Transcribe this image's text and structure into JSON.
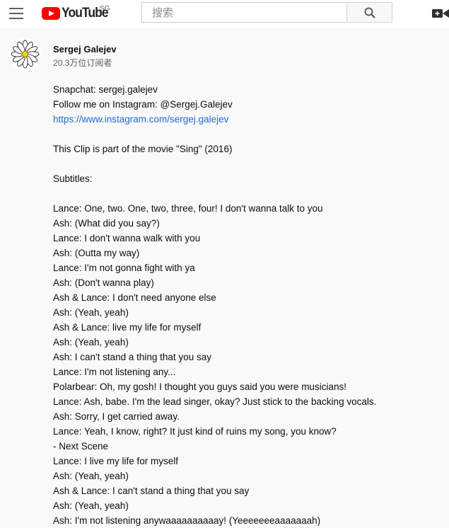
{
  "header": {
    "logo_text": "YouTube",
    "region": "SG",
    "search_placeholder": "搜索"
  },
  "channel": {
    "name": "Sergej Galejev",
    "subscribers": "20.3万位订阅者"
  },
  "description": {
    "snapchat": "Snapchat: sergej.galejev",
    "instagram": "Follow me on Instagram: @Sergej.Galejev",
    "link": "https://www.instagram.com/sergej.galejev",
    "clip": "This Clip is part of the movie \"Sing\" (2016)",
    "subtitles_heading": "Subtitles:",
    "lines": [
      "Lance: One, two. One, two, three, four! I don't wanna talk to you",
      "Ash: (What did you say?)",
      "Lance: I don't wanna walk with you",
      "Ash: (Outta my way)",
      "Lance: I'm not gonna fight with ya",
      "Ash: (Don't wanna play)",
      "Ash & Lance: I don't need anyone else",
      "Ash: (Yeah, yeah)",
      "Ash & Lance: live my life for myself",
      "Ash: (Yeah, yeah)",
      "Ash: I can't stand a thing that you say",
      "Lance: I'm not listening any...",
      "Polarbear: Oh, my gosh! I thought you guys said you were musicians!",
      "Lance: Ash, babe. I'm the lead singer, okay? Just stick to the backing vocals.",
      "Ash: Sorry, I get carried away.",
      "Lance: Yeah, I know, right? It just kind of ruins my song, you know?",
      "- Next Scene",
      "Lance: I live my life for myself",
      "Ash: (Yeah, yeah)",
      "Ash & Lance: I can't stand a thing that you say",
      "Ash: (Yeah, yeah)",
      "Ash: I'm not listening anywaaaaaaaaaay! (Yeeeeeeeaaaaaaah)"
    ]
  }
}
